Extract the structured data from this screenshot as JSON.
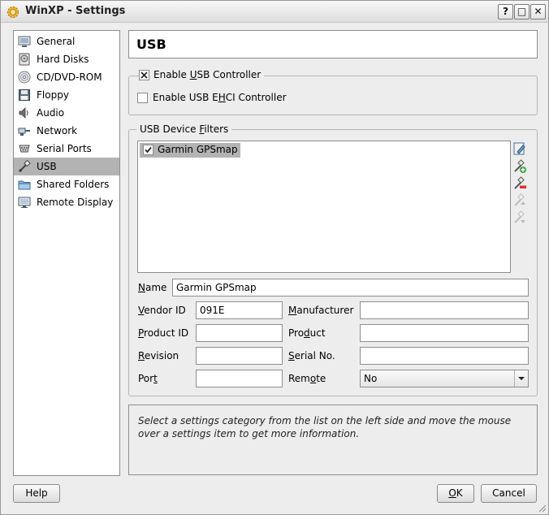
{
  "window": {
    "title": "WinXP - Settings",
    "buttons": {
      "help": "?",
      "maximize": "□",
      "close": "✕"
    }
  },
  "sidebar": {
    "items": [
      {
        "label": "General",
        "icon": "general-icon"
      },
      {
        "label": "Hard Disks",
        "icon": "hard-disk-icon"
      },
      {
        "label": "CD/DVD-ROM",
        "icon": "cd-dvd-icon"
      },
      {
        "label": "Floppy",
        "icon": "floppy-icon"
      },
      {
        "label": "Audio",
        "icon": "audio-icon"
      },
      {
        "label": "Network",
        "icon": "network-icon"
      },
      {
        "label": "Serial Ports",
        "icon": "serial-port-icon"
      },
      {
        "label": "USB",
        "icon": "usb-icon",
        "selected": true
      },
      {
        "label": "Shared Folders",
        "icon": "shared-folder-icon"
      },
      {
        "label": "Remote Display",
        "icon": "remote-display-icon"
      }
    ]
  },
  "page": {
    "title": "USB"
  },
  "usb_controller": {
    "enable_usb": {
      "pre": "Enable ",
      "key": "U",
      "post": "SB Controller",
      "checked": true
    },
    "enable_ehci": {
      "pre": "Enable USB E",
      "key": "H",
      "post": "CI Controller",
      "checked": false
    }
  },
  "filters": {
    "legend": {
      "pre": "USB Device ",
      "key": "F",
      "post": "ilters"
    },
    "items": [
      {
        "label": "Garmin GPSmap",
        "checked": true
      }
    ],
    "tools": [
      "edit-filter-icon",
      "add-filter-icon",
      "remove-filter-icon",
      "move-up-icon",
      "move-down-icon"
    ]
  },
  "details": {
    "name": {
      "key": "N",
      "rest": "ame",
      "value": "Garmin GPSmap"
    },
    "vendor_id": {
      "key": "V",
      "rest": "endor ID",
      "value": "091E"
    },
    "manufacturer": {
      "key": "M",
      "rest": "anufacturer",
      "value": ""
    },
    "product_id": {
      "key": "P",
      "rest": "roduct ID",
      "value": ""
    },
    "product": {
      "pre": "Pro",
      "key": "d",
      "post": "uct",
      "value": ""
    },
    "revision": {
      "key": "R",
      "rest": "evision",
      "value": ""
    },
    "serial_no": {
      "key": "S",
      "rest": "erial No.",
      "value": ""
    },
    "port": {
      "pre": "Por",
      "key": "t",
      "post": "",
      "value": ""
    },
    "remote": {
      "pre": "Rem",
      "key": "o",
      "post": "te",
      "value": "No"
    }
  },
  "info": {
    "text": "Select a settings category from the list on the left side and move the mouse over a settings item to get more information."
  },
  "footer": {
    "help": "Help",
    "ok": {
      "key": "O",
      "rest": "K"
    },
    "cancel": "Cancel"
  }
}
